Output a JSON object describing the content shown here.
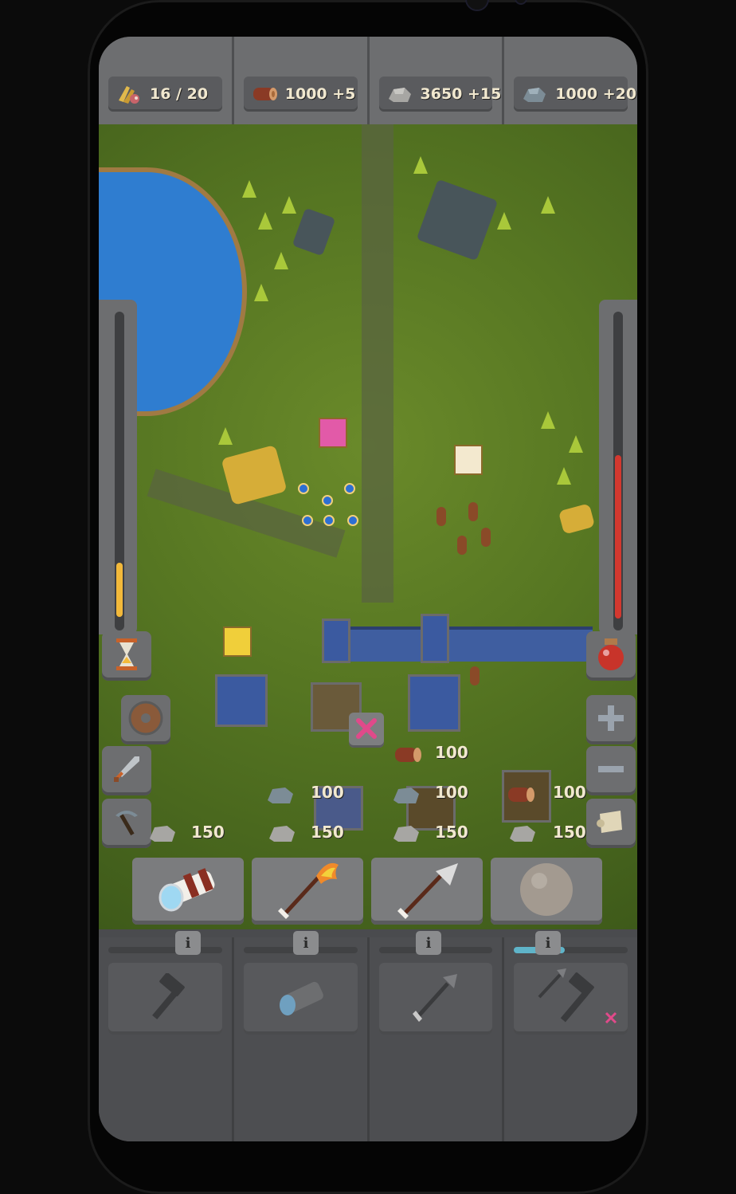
{
  "resources": [
    {
      "icon": "food-icon",
      "value": "16 / 20"
    },
    {
      "icon": "wood-icon",
      "value": "1000 +5"
    },
    {
      "icon": "stone-icon",
      "value": "3650 +15"
    },
    {
      "icon": "iron-icon",
      "value": "1000 +20"
    }
  ],
  "gauges": {
    "left_level": 0.17,
    "right_level": 0.51
  },
  "left_buttons": [
    {
      "icon": "hourglass-icon"
    },
    {
      "icon": "shield-icon"
    },
    {
      "icon": "sword-icon"
    },
    {
      "icon": "pickaxe-icon"
    }
  ],
  "right_buttons": [
    {
      "icon": "potion-icon"
    },
    {
      "icon": "zoom-in-icon"
    },
    {
      "icon": "zoom-out-icon"
    },
    {
      "icon": "scroll-icon"
    }
  ],
  "build_costs": [
    {
      "icon": "wood-icon",
      "value": "100"
    },
    {
      "icon": "stone-icon",
      "value": "100"
    },
    {
      "icon": "stone-icon",
      "value": "100"
    },
    {
      "icon": "wood-icon",
      "value": "100"
    },
    {
      "icon": "stone-icon",
      "value": "150"
    },
    {
      "icon": "stone-icon",
      "value": "150"
    },
    {
      "icon": "stone-icon",
      "value": "150"
    },
    {
      "icon": "stone-icon",
      "value": "150"
    }
  ],
  "weapons": [
    {
      "icon": "spyglass-icon",
      "info": "i"
    },
    {
      "icon": "fire-arrow-icon",
      "info": "i"
    },
    {
      "icon": "arrow-icon",
      "info": "i"
    },
    {
      "icon": "boulder-icon",
      "info": "i"
    }
  ],
  "bottom_slots": [
    {
      "icon": "hammer-icon",
      "progress": 0
    },
    {
      "icon": "spyglass-icon",
      "progress": 0
    },
    {
      "icon": "arrow-icon",
      "progress": 0
    },
    {
      "icon": "arrow-hammer-icon",
      "progress": 0.45
    }
  ],
  "colors": {
    "accent_red": "#d3382f",
    "accent_gold": "#f3b93a",
    "delete_pink": "#e04a8a",
    "progress_teal": "#5fb4c9"
  }
}
